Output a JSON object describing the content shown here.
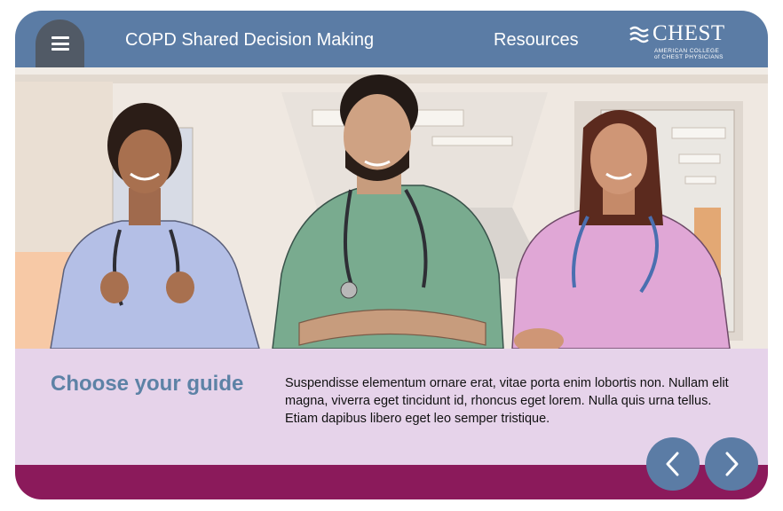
{
  "header": {
    "title": "COPD Shared Decision Making",
    "resources_label": "Resources",
    "logo": {
      "wordmark": "CHEST",
      "line1": "AMERICAN COLLEGE",
      "line2": "of CHEST PHYSICIANS"
    }
  },
  "caption": {
    "title": "Choose your guide",
    "body": "Suspendisse elementum ornare erat, vitae porta enim lobortis non. Nullam elit magna, viverra eget tincidunt id, rhoncus eget lorem. Nulla quis urna tellus. Etiam dapibus libero eget leo semper tristique."
  },
  "colors": {
    "header": "#5b7ca5",
    "menu_button": "#515a66",
    "caption_band": "#e6d3ea",
    "caption_title": "#5d82a6",
    "footer": "#8b1a5b"
  },
  "icons": {
    "menu": "hamburger-icon",
    "logo_mark": "chest-waves-icon",
    "prev": "chevron-left-icon",
    "next": "chevron-right-icon"
  }
}
